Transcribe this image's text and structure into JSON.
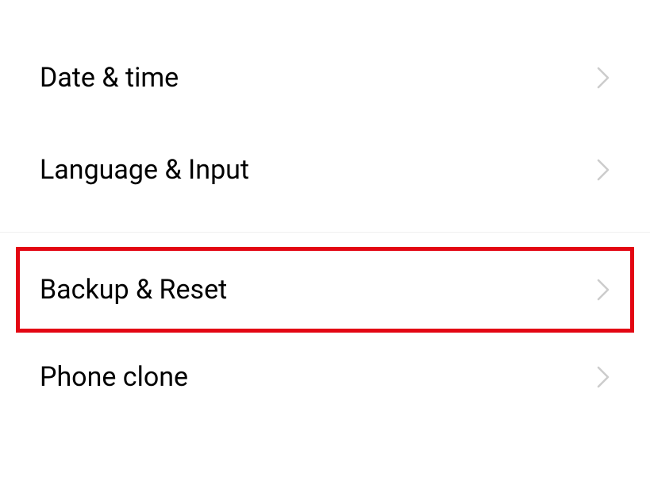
{
  "items": {
    "dateTime": {
      "label": "Date & time"
    },
    "languageInput": {
      "label": "Language & Input"
    },
    "backupReset": {
      "label": "Backup & Reset"
    },
    "phoneClone": {
      "label": "Phone clone"
    }
  },
  "colors": {
    "highlight": "#e30613",
    "chevron": "#cccccc"
  }
}
